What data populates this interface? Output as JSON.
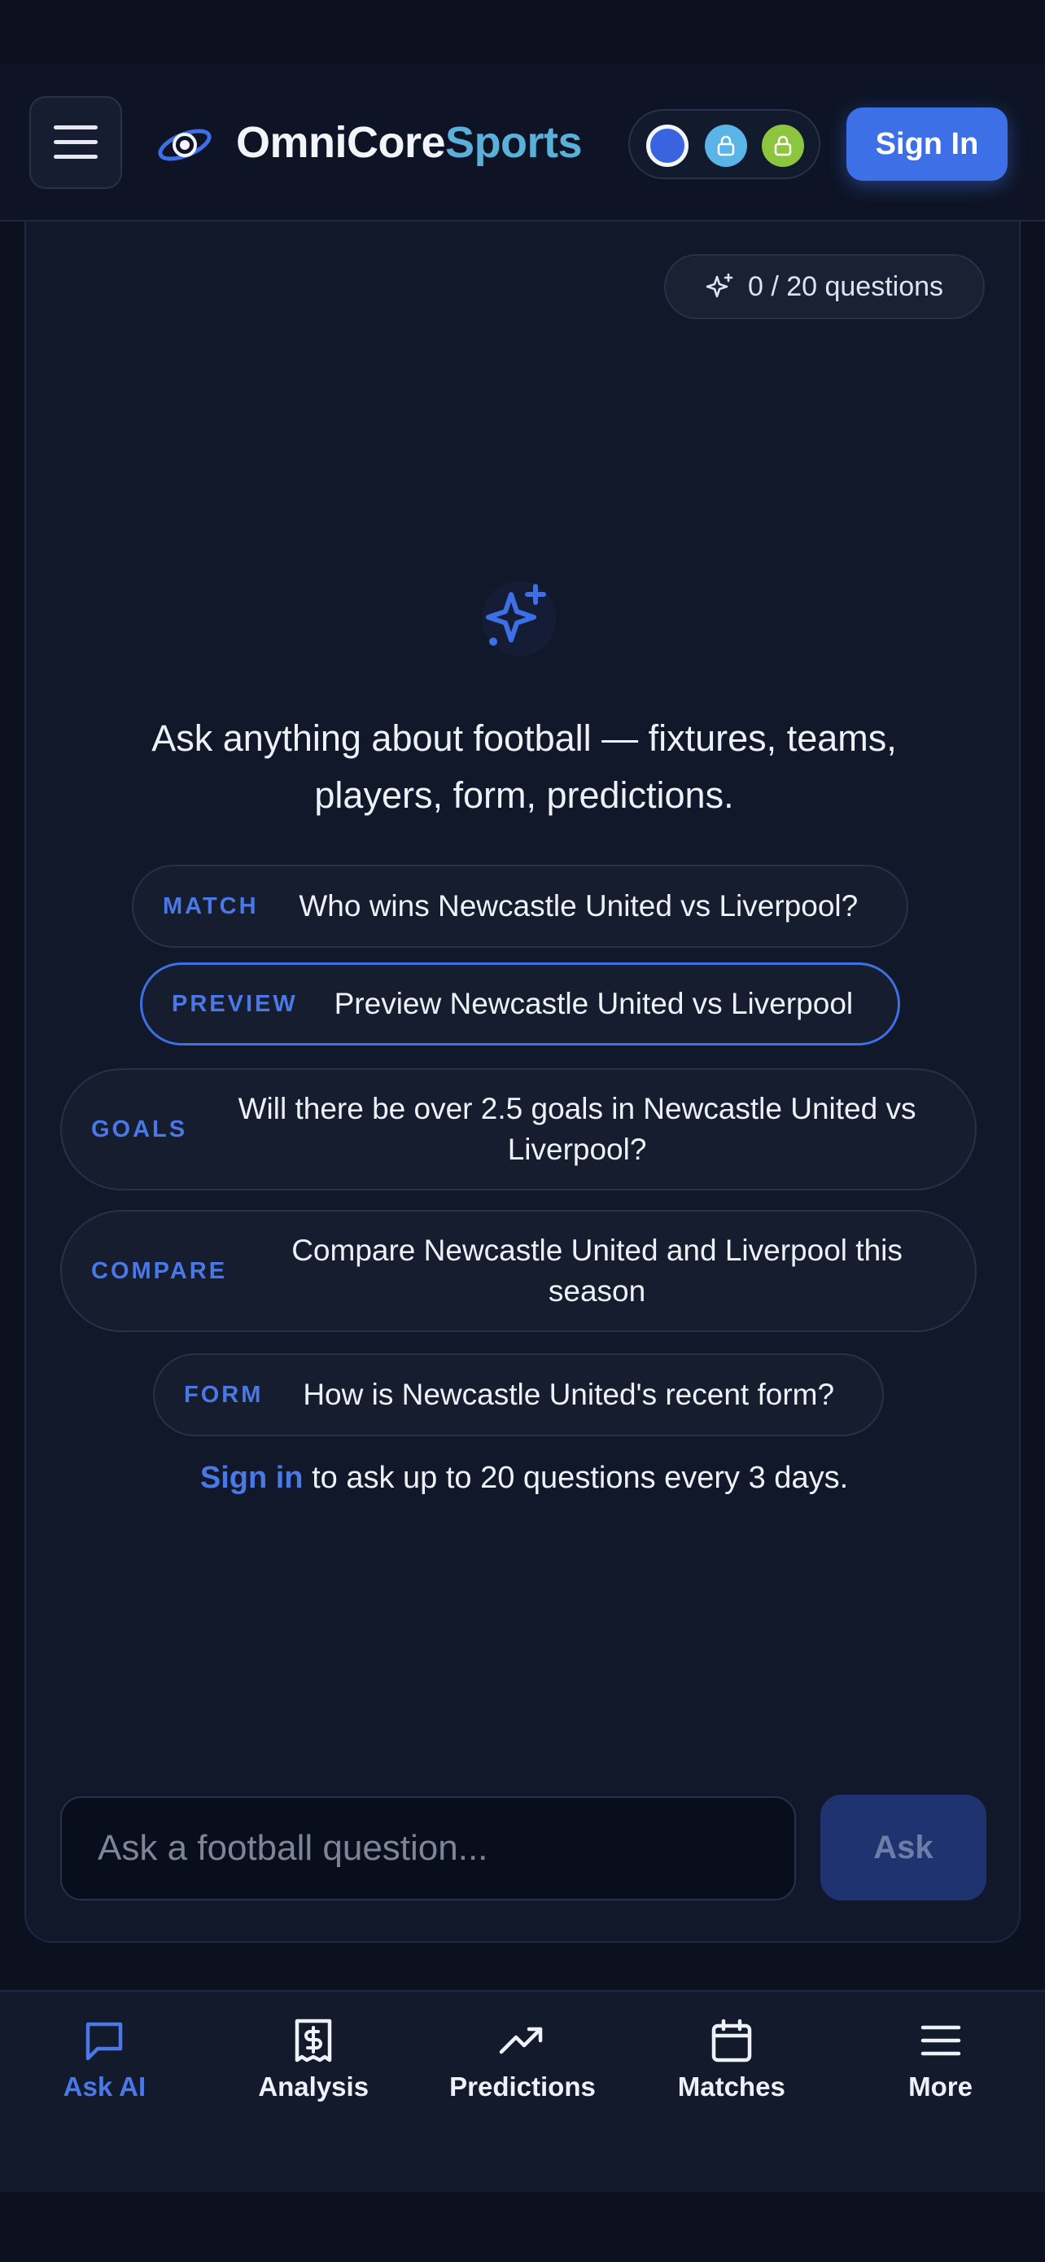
{
  "header": {
    "brand_part1": "OmniCore",
    "brand_part2": "Sports",
    "sign_in_label": "Sign In"
  },
  "quota": {
    "label": "0 / 20 questions"
  },
  "main": {
    "prompt": "Ask anything about football — fixtures, teams, players, form, predictions.",
    "suggestions": [
      {
        "tag": "MATCH",
        "text": "Who wins Newcastle United vs Liverpool?"
      },
      {
        "tag": "PREVIEW",
        "text": "Preview Newcastle United vs Liverpool"
      },
      {
        "tag": "GOALS",
        "text": "Will there be over 2.5 goals in Newcastle United vs Liverpool?"
      },
      {
        "tag": "COMPARE",
        "text": "Compare Newcastle United and Liverpool this season"
      },
      {
        "tag": "FORM",
        "text": "How is Newcastle United's recent form?"
      }
    ],
    "signin_link": "Sign in",
    "signin_note": " to ask up to 20 questions every 3 days."
  },
  "ask": {
    "placeholder": "Ask a football question...",
    "button_label": "Ask"
  },
  "nav": {
    "items": [
      {
        "label": "Ask AI",
        "icon": "chat-icon",
        "active": true
      },
      {
        "label": "Analysis",
        "icon": "receipt-dollar-icon"
      },
      {
        "label": "Predictions",
        "icon": "trend-up-icon"
      },
      {
        "label": "Matches",
        "icon": "calendar-icon"
      },
      {
        "label": "More",
        "icon": "menu-icon"
      }
    ]
  },
  "colors": {
    "accent": "#3d6fe6",
    "brand_secondary": "#5ab0d9",
    "background": "#0c1120",
    "swatches": [
      "#3a63e0",
      "#5ab4e6",
      "#8cc63f"
    ]
  }
}
